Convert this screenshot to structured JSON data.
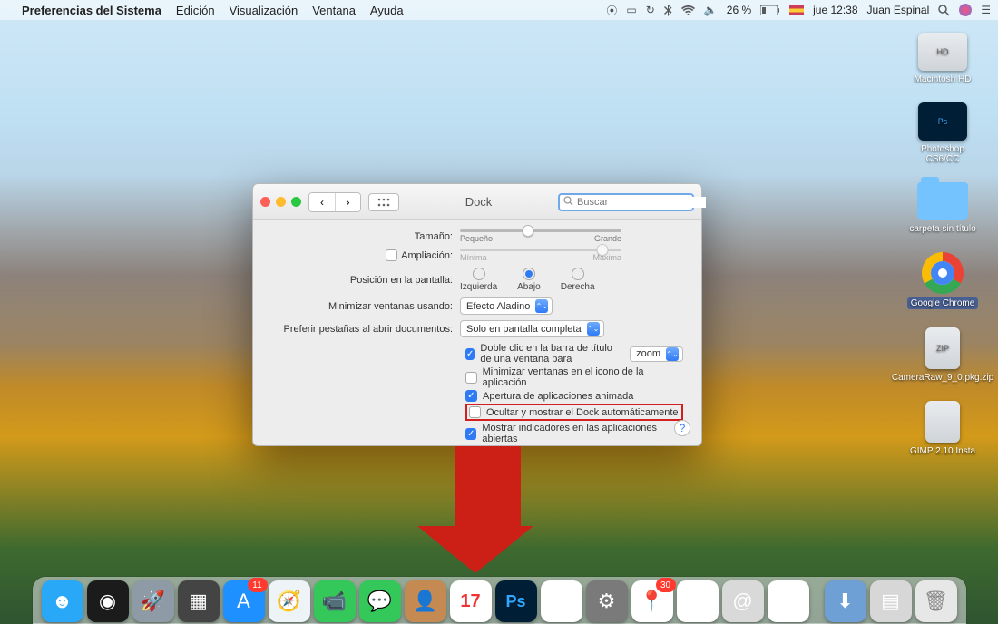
{
  "menubar": {
    "app": "Preferencias del Sistema",
    "items": [
      "Edición",
      "Visualización",
      "Ventana",
      "Ayuda"
    ],
    "battery": "26 %",
    "clock": "jue 12:38",
    "user": "Juan Espinal"
  },
  "desktop": {
    "hd": "Macintosh HD",
    "ps": "Photoshop CS6/CC",
    "folder": "carpeta sin título",
    "chrome": "Google Chrome",
    "zip": "CameraRaw_9_0.pkg.zip",
    "gimp": "GIMP 2.10 Insta"
  },
  "win": {
    "title": "Dock",
    "search_placeholder": "Buscar",
    "size_label": "Tamaño:",
    "size_min": "Pequeño",
    "size_max": "Grande",
    "mag_label": "Ampliación:",
    "mag_min": "Mínima",
    "mag_max": "Máxima",
    "pos_label": "Posición en la pantalla:",
    "pos_left": "Izquierda",
    "pos_center": "Abajo",
    "pos_right": "Derecha",
    "min_label": "Minimizar ventanas usando:",
    "min_value": "Efecto Aladino",
    "tabs_label": "Preferir pestañas al abrir documentos:",
    "tabs_value": "Solo en pantalla completa",
    "dblclick": "Doble clic en la barra de título de una ventana para",
    "dblclick_value": "zoom",
    "min_to_icon": "Minimizar ventanas en el icono de la aplicación",
    "anim_open": "Apertura de aplicaciones animada",
    "autohide": "Ocultar y mostrar el Dock automáticamente",
    "indicators": "Mostrar indicadores en las aplicaciones abiertas"
  },
  "dock_items": [
    {
      "name": "finder",
      "bg": "#2aa8f8",
      "glyph": "☻"
    },
    {
      "name": "siri",
      "bg": "#1b1b1b",
      "glyph": "◉"
    },
    {
      "name": "launchpad",
      "bg": "#8e9aa6",
      "glyph": "🚀"
    },
    {
      "name": "mission",
      "bg": "#444",
      "glyph": "▦"
    },
    {
      "name": "appstore",
      "bg": "#1e90ff",
      "glyph": "A",
      "badge": "11"
    },
    {
      "name": "safari",
      "bg": "#eef3f8",
      "glyph": "🧭"
    },
    {
      "name": "facetime",
      "bg": "#34c759",
      "glyph": "📹"
    },
    {
      "name": "messages",
      "bg": "#34c759",
      "glyph": "💬"
    },
    {
      "name": "contacts",
      "bg": "#c58a52",
      "glyph": "👤"
    },
    {
      "name": "calendar",
      "bg": "#fff",
      "glyph": "17"
    },
    {
      "name": "photoshop",
      "bg": "#001e36",
      "glyph": "Ps"
    },
    {
      "name": "itunes",
      "bg": "#fff",
      "glyph": "♪"
    },
    {
      "name": "sysprefs",
      "bg": "#7a7a7a",
      "glyph": "⚙"
    },
    {
      "name": "maps",
      "bg": "#fff",
      "glyph": "📍",
      "badge": "30"
    },
    {
      "name": "photos",
      "bg": "#fff",
      "glyph": "✿"
    },
    {
      "name": "mail",
      "bg": "#d9d9d9",
      "glyph": "@"
    },
    {
      "name": "chrome",
      "bg": "#fff",
      "glyph": "◉"
    }
  ],
  "dock_right": [
    {
      "name": "downloads",
      "bg": "#6ea0d6",
      "glyph": "⬇"
    },
    {
      "name": "stack",
      "bg": "#d7d7d7",
      "glyph": "▤"
    },
    {
      "name": "trash",
      "bg": "#e7e7e7",
      "glyph": "🗑"
    }
  ]
}
